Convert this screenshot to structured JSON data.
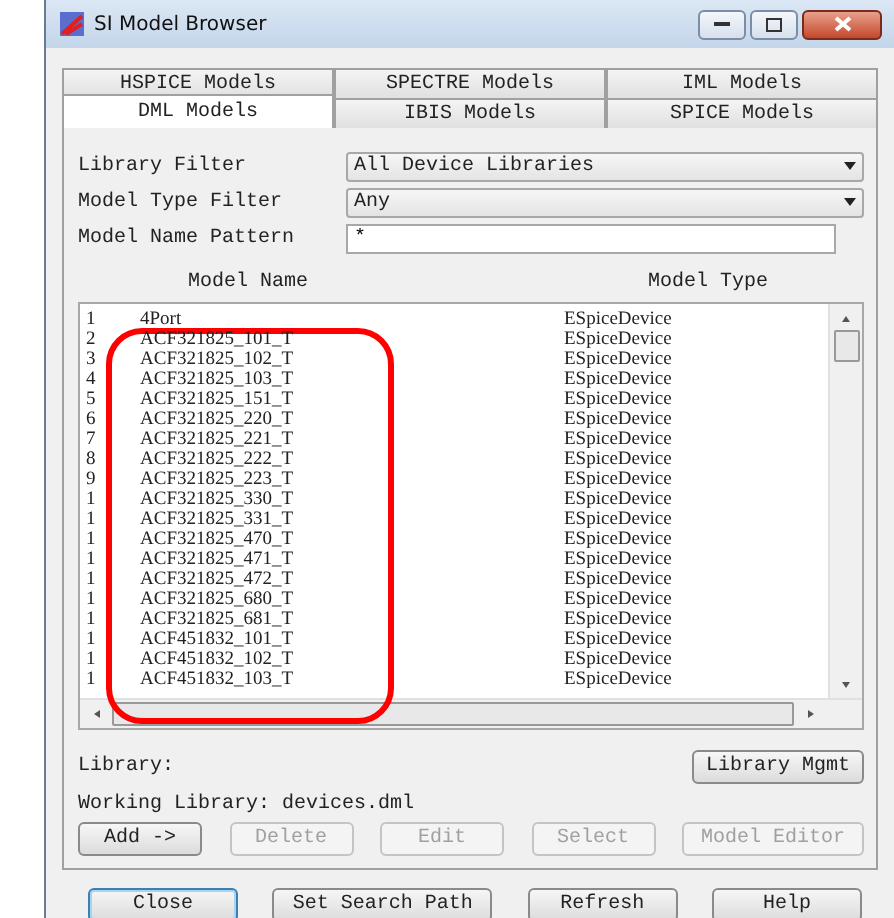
{
  "window": {
    "title": "SI Model Browser"
  },
  "tabs_back": [
    {
      "label": "HSPICE Models",
      "selected": false
    },
    {
      "label": "SPECTRE Models",
      "selected": false
    },
    {
      "label": "IML Models",
      "selected": false
    }
  ],
  "tabs_front": [
    {
      "label": "DML Models",
      "selected": true
    },
    {
      "label": "IBIS Models",
      "selected": false
    },
    {
      "label": "SPICE Models",
      "selected": false
    }
  ],
  "filters": [
    {
      "kind": "dropdown",
      "label": "Library Filter",
      "value": "All Device Libraries"
    },
    {
      "kind": "dropdown",
      "label": "Model Type Filter",
      "value": "Any"
    },
    {
      "kind": "text",
      "label": "Model Name Pattern",
      "value": "*"
    }
  ],
  "table": {
    "columns": [
      "Model Name",
      "Model Type"
    ],
    "rows": [
      {
        "index": "1",
        "name": "4Port",
        "type": "ESpiceDevice"
      },
      {
        "index": "2",
        "name": "ACF321825_101_T",
        "type": "ESpiceDevice"
      },
      {
        "index": "3",
        "name": "ACF321825_102_T",
        "type": "ESpiceDevice"
      },
      {
        "index": "4",
        "name": "ACF321825_103_T",
        "type": "ESpiceDevice"
      },
      {
        "index": "5",
        "name": "ACF321825_151_T",
        "type": "ESpiceDevice"
      },
      {
        "index": "6",
        "name": "ACF321825_220_T",
        "type": "ESpiceDevice"
      },
      {
        "index": "7",
        "name": "ACF321825_221_T",
        "type": "ESpiceDevice"
      },
      {
        "index": "8",
        "name": "ACF321825_222_T",
        "type": "ESpiceDevice"
      },
      {
        "index": "9",
        "name": "ACF321825_223_T",
        "type": "ESpiceDevice"
      },
      {
        "index": "1",
        "name": "ACF321825_330_T",
        "type": "ESpiceDevice"
      },
      {
        "index": "1",
        "name": "ACF321825_331_T",
        "type": "ESpiceDevice"
      },
      {
        "index": "1",
        "name": "ACF321825_470_T",
        "type": "ESpiceDevice"
      },
      {
        "index": "1",
        "name": "ACF321825_471_T",
        "type": "ESpiceDevice"
      },
      {
        "index": "1",
        "name": "ACF321825_472_T",
        "type": "ESpiceDevice"
      },
      {
        "index": "1",
        "name": "ACF321825_680_T",
        "type": "ESpiceDevice"
      },
      {
        "index": "1",
        "name": "ACF321825_681_T",
        "type": "ESpiceDevice"
      },
      {
        "index": "1",
        "name": "ACF451832_101_T",
        "type": "ESpiceDevice"
      },
      {
        "index": "1",
        "name": "ACF451832_102_T",
        "type": "ESpiceDevice"
      },
      {
        "index": "1",
        "name": "ACF451832_103_T",
        "type": "ESpiceDevice"
      }
    ]
  },
  "library_label": "Library:",
  "library_button": "Library Mgmt",
  "working_library": "Working Library: devices.dml",
  "actions": [
    {
      "label": "Add ->",
      "disabled": false
    },
    {
      "label": "Delete",
      "disabled": true
    },
    {
      "label": "Edit",
      "disabled": true
    },
    {
      "label": "Select",
      "disabled": true
    },
    {
      "label": "Model Editor",
      "disabled": true
    }
  ],
  "bottom_buttons": [
    {
      "label": "Close",
      "selected": true
    },
    {
      "label": "Set Search Path",
      "selected": false
    },
    {
      "label": "Refresh",
      "selected": false
    },
    {
      "label": "Help",
      "selected": false
    }
  ]
}
